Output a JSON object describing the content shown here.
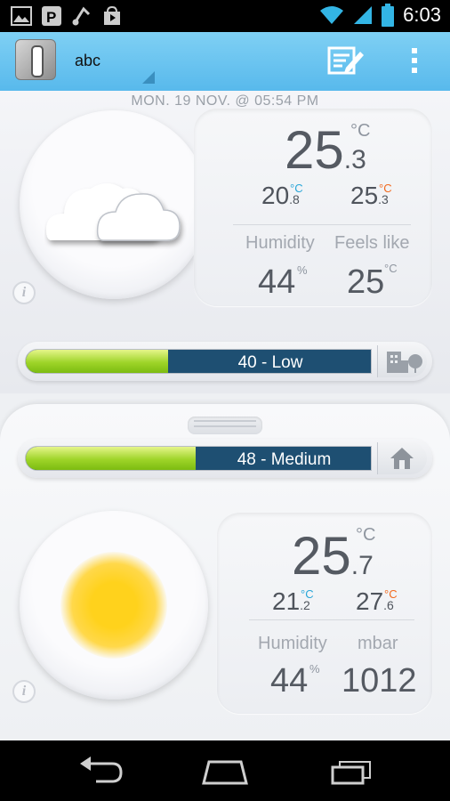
{
  "status_bar": {
    "time": "6:03",
    "left_icons": [
      "image-icon",
      "parking-icon",
      "music-note-icon",
      "shopping-bag-icon"
    ],
    "right_icons": [
      "wifi-icon",
      "signal-icon",
      "battery-icon"
    ]
  },
  "action_bar": {
    "station_name": "abc",
    "edit_icon": "edit-note-icon",
    "overflow_icon": "overflow-menu-icon"
  },
  "timestamp": "MON. 19 NOV. @ 05:54 PM",
  "outdoor": {
    "condition_icon": "cloud-icon",
    "temperature_int": "25",
    "temperature_dec": ".3",
    "temperature_unit": "°C",
    "min_int": "20",
    "min_dec": ".8",
    "min_unit": "°C",
    "max_int": "25",
    "max_dec": ".3",
    "max_unit": "°C",
    "humidity_label": "Humidity",
    "humidity_value": "44",
    "humidity_unit": "%",
    "feels_label": "Feels like",
    "feels_value": "25",
    "feels_unit": "°C",
    "air_quality": {
      "label": "40 - Low",
      "level": 0.41,
      "icon": "city-tree-icon"
    }
  },
  "indoor": {
    "air_quality": {
      "label": "48 - Medium",
      "level": 0.49,
      "icon": "home-icon"
    },
    "condition_icon": "sun-icon",
    "temperature_int": "25",
    "temperature_dec": ".7",
    "temperature_unit": "°C",
    "min_int": "21",
    "min_dec": ".2",
    "min_unit": "°C",
    "max_int": "27",
    "max_dec": ".6",
    "max_unit": "°C",
    "humidity_label": "Humidity",
    "humidity_value": "44",
    "humidity_unit": "%",
    "pressure_label": "mbar",
    "pressure_value": "1012"
  },
  "colors": {
    "action_bar": "#58b9ec",
    "min_temp": "#29a6d8",
    "max_temp": "#f26a1e",
    "aq_track": "#1e4f72",
    "aq_fill": "#9ed429"
  },
  "nav_bar": [
    "back-icon",
    "home-icon",
    "recent-apps-icon"
  ]
}
